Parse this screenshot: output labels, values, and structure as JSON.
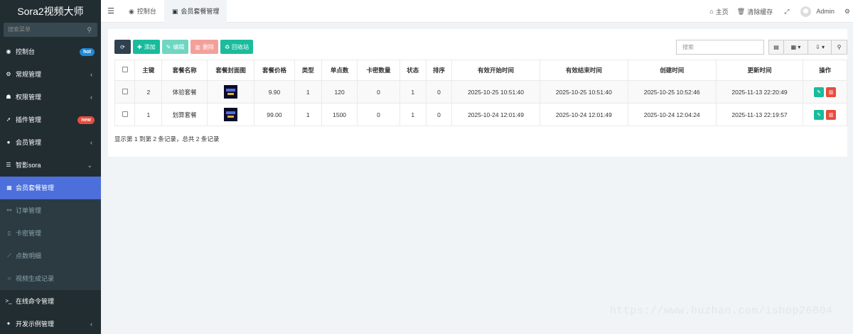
{
  "app": {
    "title": "Sora2视频大师"
  },
  "sidebar": {
    "search_placeholder": "搜索菜单",
    "items": [
      {
        "label": "控制台",
        "icon": "dashboard-icon",
        "badge": "hot"
      },
      {
        "label": "常规管理",
        "icon": "cogs-icon"
      },
      {
        "label": "权限管理",
        "icon": "group-icon"
      },
      {
        "label": "插件管理",
        "icon": "rocket-icon",
        "badge": "new"
      },
      {
        "label": "会员管理",
        "icon": "user-icon"
      },
      {
        "label": "智影sora",
        "icon": "list-icon"
      }
    ],
    "sub_items": [
      {
        "label": "会员套餐管理",
        "icon": "table-icon"
      },
      {
        "label": "订单管理",
        "icon": "sitemap-icon"
      },
      {
        "label": "卡密管理",
        "icon": "file-icon"
      },
      {
        "label": "点数明细",
        "icon": "chart-icon"
      },
      {
        "label": "视频生成记录",
        "icon": "circle-icon"
      }
    ],
    "bottom_items": [
      {
        "label": "在线命令管理",
        "icon": "terminal-icon"
      },
      {
        "label": "开发示例管理",
        "icon": "magic-icon"
      }
    ]
  },
  "topbar": {
    "tabs": [
      {
        "label": "控制台",
        "icon": "dashboard-icon"
      },
      {
        "label": "会员套餐管理",
        "icon": "table-icon"
      }
    ],
    "home": "主页",
    "clear_cache": "清除缓存",
    "user": "Admin"
  },
  "toolbar": {
    "add": "添加",
    "edit": "编辑",
    "delete": "删除",
    "recycle": "回收站",
    "search_placeholder": "搜索"
  },
  "table": {
    "columns": [
      "主键",
      "套餐名称",
      "套餐封面图",
      "套餐价格",
      "类型",
      "单点数",
      "卡密数量",
      "状态",
      "排序",
      "有效开始时间",
      "有效结束时间",
      "创建时间",
      "更新时间",
      "操作"
    ],
    "rows": [
      {
        "id": "2",
        "name": "体验套餐",
        "price": "9.90",
        "type": "1",
        "points": "120",
        "cards": "0",
        "status": "1",
        "sort": "0",
        "start": "2025-10-25 10:51:40",
        "end": "2025-10-25 10:51:40",
        "created": "2025-10-25 10:52:46",
        "updated": "2025-11-13 22:20:49"
      },
      {
        "id": "1",
        "name": "划算套餐",
        "price": "99.00",
        "type": "1",
        "points": "1500",
        "cards": "0",
        "status": "1",
        "sort": "0",
        "start": "2025-10-24 12:01:49",
        "end": "2025-10-24 12:01:49",
        "created": "2025-10-24 12:04:24",
        "updated": "2025-11-13 22:19:57"
      }
    ]
  },
  "summary": "显示第 1 到第 2 条记录，总共 2 条记录",
  "watermark": "https://www.huzhan.com/ishop26804"
}
